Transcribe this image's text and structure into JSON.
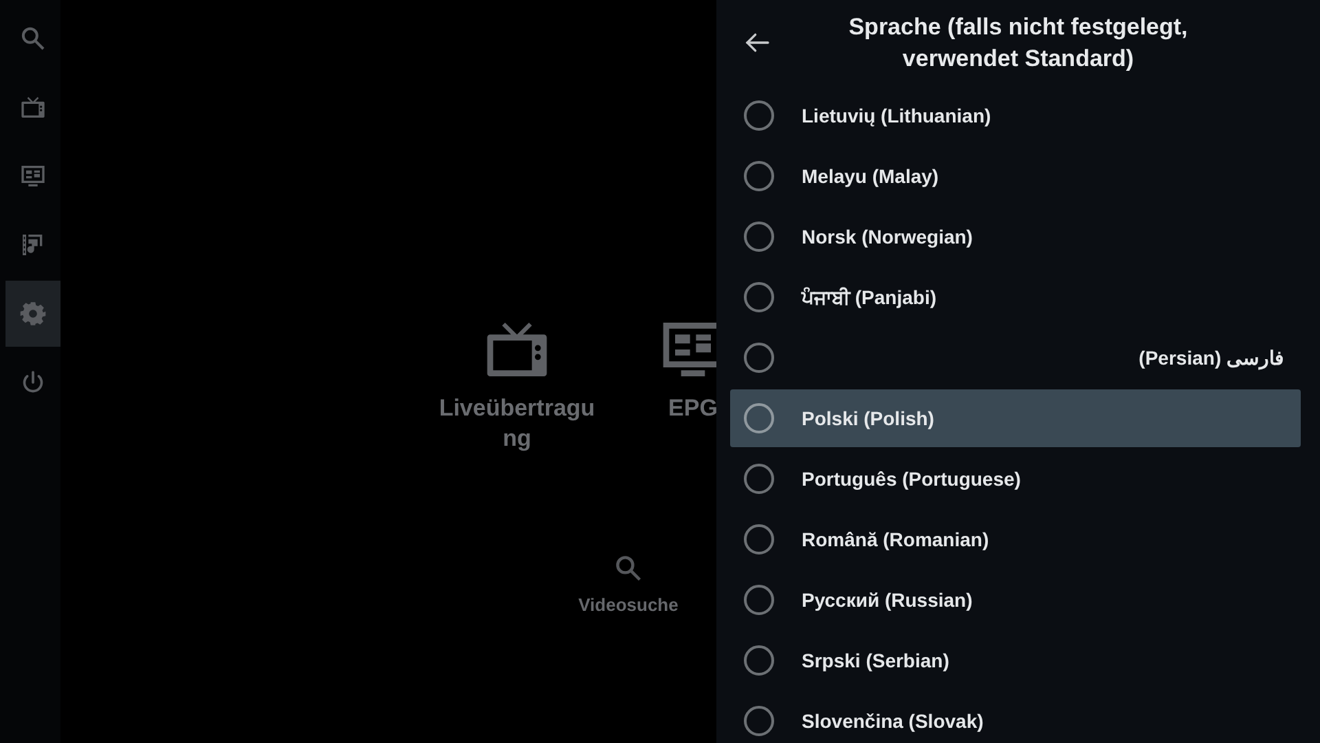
{
  "sidebar": {
    "items": [
      {
        "kind": "search",
        "selected": false
      },
      {
        "kind": "tv",
        "selected": false
      },
      {
        "kind": "guide",
        "selected": false
      },
      {
        "kind": "media",
        "selected": false
      },
      {
        "kind": "settings",
        "selected": true
      },
      {
        "kind": "power",
        "selected": false
      }
    ]
  },
  "tiles": [
    {
      "kind": "tv",
      "label": "Liveübertragung"
    },
    {
      "kind": "guide",
      "label": "EPG"
    }
  ],
  "shortcuts": [
    {
      "kind": "search",
      "label": "Videosuche"
    }
  ],
  "dialog": {
    "title": "Sprache (falls nicht festgelegt, verwendet Standard)",
    "options": [
      {
        "label": "Lietuvių (Lithuanian)",
        "selected": false,
        "rtl": false
      },
      {
        "label": "Melayu (Malay)",
        "selected": false,
        "rtl": false
      },
      {
        "label": "Norsk (Norwegian)",
        "selected": false,
        "rtl": false
      },
      {
        "label": "ਪੰਜਾਬੀ (Panjabi)",
        "selected": false,
        "rtl": false
      },
      {
        "label": "فارسی (Persian)",
        "selected": false,
        "rtl": true
      },
      {
        "label": "Polski (Polish)",
        "selected": true,
        "rtl": false
      },
      {
        "label": "Português (Portuguese)",
        "selected": false,
        "rtl": false
      },
      {
        "label": "Română (Romanian)",
        "selected": false,
        "rtl": false
      },
      {
        "label": "Русский (Russian)",
        "selected": false,
        "rtl": false
      },
      {
        "label": "Srpski (Serbian)",
        "selected": false,
        "rtl": false
      },
      {
        "label": "Slovenčina (Slovak)",
        "selected": false,
        "rtl": false
      }
    ]
  }
}
